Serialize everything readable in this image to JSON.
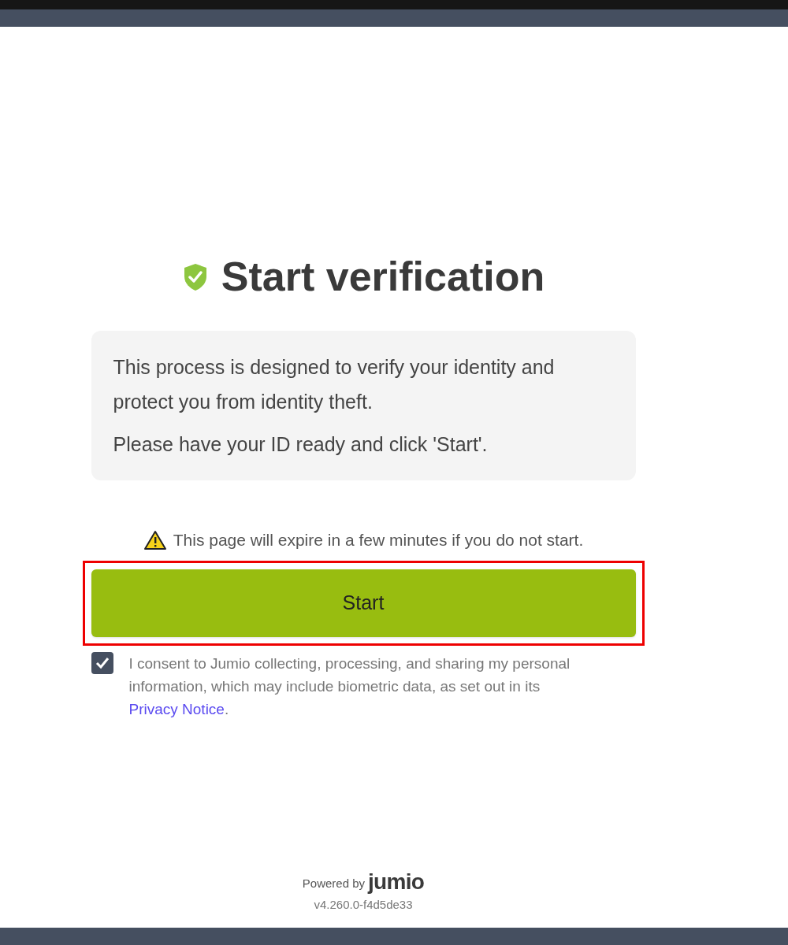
{
  "title": "Start verification",
  "info": {
    "paragraphs": [
      "This process is designed to verify your identity and protect you from identity theft.",
      "Please have your ID ready and click 'Start'."
    ]
  },
  "warning": "This page will expire in a few minutes if you do not start.",
  "start_button": {
    "label": "Start",
    "highlighted": true
  },
  "consent": {
    "checked": true,
    "text": "I consent to Jumio collecting, processing, and sharing my personal information, which may include biometric data, as set out in its",
    "link": "Privacy Notice",
    "after_link": "."
  },
  "footer": {
    "powered_by": "Powered by",
    "brand": "jumio",
    "version": "v4.260.0-f4d5de33"
  }
}
